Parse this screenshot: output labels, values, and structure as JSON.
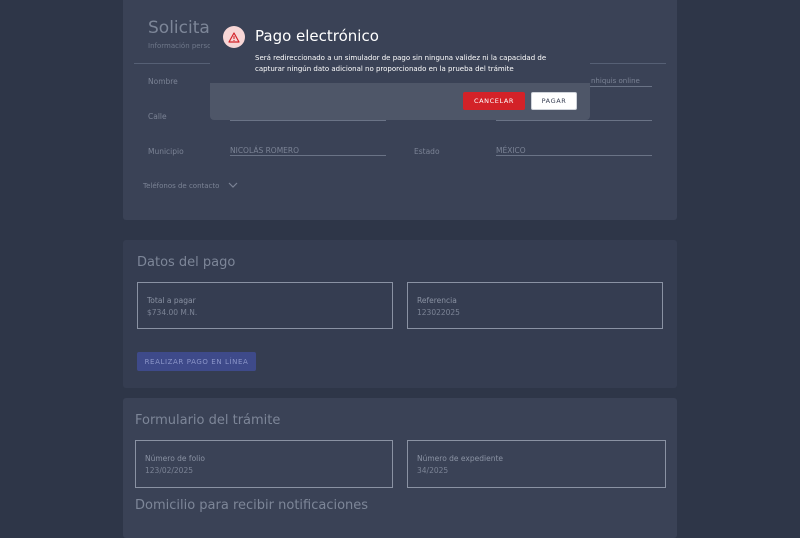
{
  "requester": {
    "title": "Solicitar",
    "subtitle": "Información perso",
    "name_label": "Nombre",
    "street_label": "Calle",
    "municipality_label": "Municipio",
    "municipality_value": "NICOLÁS ROMERO",
    "state_label": "Estado",
    "state_value": "MÉXICO",
    "partial_value": "nhiquis online",
    "phones_toggle": "Teléfonos de contacto"
  },
  "payment": {
    "title": "Datos del pago",
    "total_label": "Total a pagar",
    "total_value": "$734.00 M.N.",
    "reference_label": "Referencia",
    "reference_value": "123022025",
    "pay_online_button": "REALIZAR PAGO EN LÍNEA"
  },
  "procedure": {
    "title": "Formulario del trámite",
    "folio_label": "Número de folio",
    "folio_value": "123/02/2025",
    "file_label": "Número de expediente",
    "file_value": "34/2025",
    "address_title": "Domicilio para recibir notificaciones"
  },
  "modal": {
    "title": "Pago electrónico",
    "message": "Será redireccionado a un simulador de pago sin ninguna validez ni la capacidad de capturar ningún dato adicional no proporcionado en la prueba del trámite",
    "cancel_label": "CANCELAR",
    "pay_label": "PAGAR",
    "icon": "warning-icon"
  }
}
